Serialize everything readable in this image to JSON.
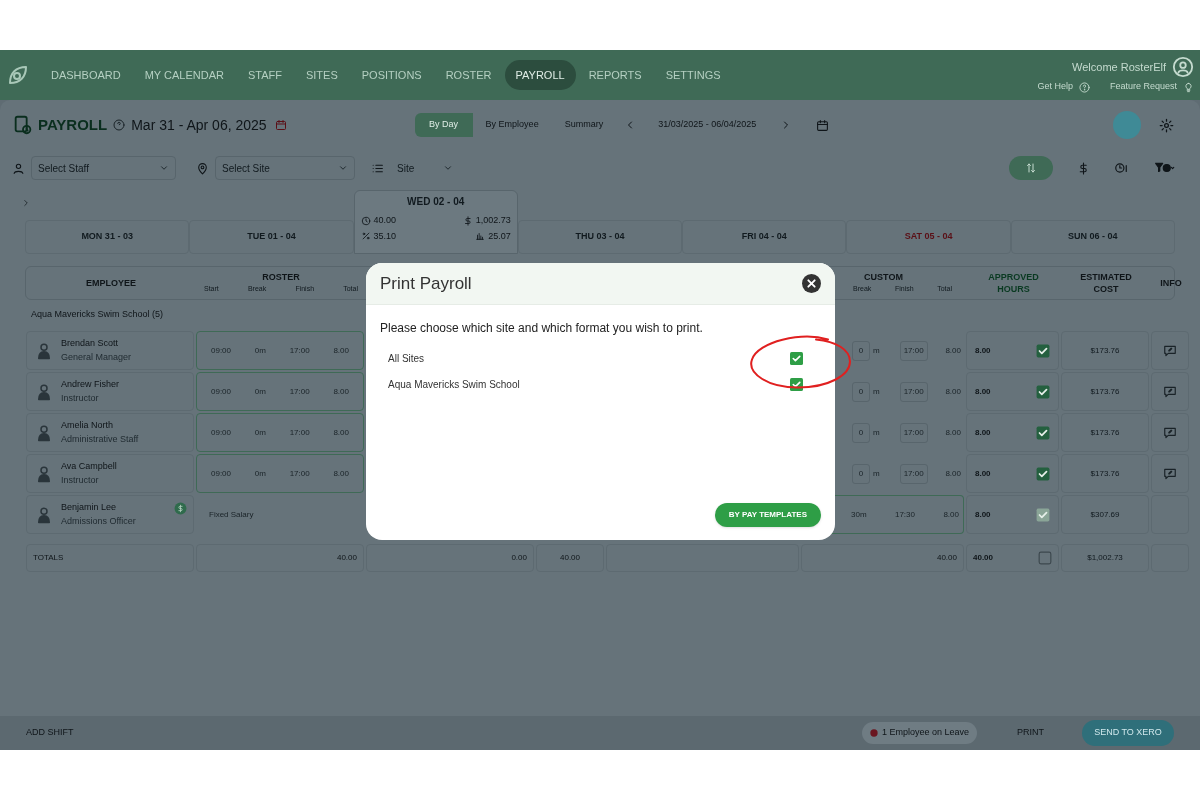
{
  "nav": {
    "items": [
      {
        "label": "DASHBOARD",
        "selected": false
      },
      {
        "label": "MY CALENDAR",
        "selected": false
      },
      {
        "label": "STAFF",
        "selected": false
      },
      {
        "label": "SITES",
        "selected": false
      },
      {
        "label": "POSITIONS",
        "selected": false
      },
      {
        "label": "ROSTER",
        "selected": false
      },
      {
        "label": "PAYROLL",
        "selected": true
      },
      {
        "label": "REPORTS",
        "selected": false
      },
      {
        "label": "SETTINGS",
        "selected": false
      }
    ],
    "welcome": "Welcome RosterElf",
    "help": "Get Help",
    "feature_request": "Feature Request"
  },
  "header": {
    "title": "PAYROLL",
    "date_range": "Mar 31 - Apr 06, 2025",
    "views": [
      {
        "label": "By Day",
        "selected": true
      },
      {
        "label": "By Employee",
        "selected": false
      },
      {
        "label": "Summary",
        "selected": false
      }
    ],
    "date_field": "31/03/2025 - 06/04/2025"
  },
  "filters": {
    "staff": {
      "placeholder": "Select Staff"
    },
    "site": {
      "placeholder": "Select Site"
    },
    "group_by": "Site"
  },
  "days": [
    {
      "label": "MON 31 - 03",
      "selected": false,
      "highlighted": false
    },
    {
      "label": "TUE 01 - 04",
      "selected": false,
      "highlighted": false
    },
    {
      "label": "WED 02 - 04",
      "selected": true,
      "highlighted": false,
      "stats": {
        "hours": "40.00",
        "cost": "1,002.73",
        "percent": "35.10",
        "average": "25.07"
      }
    },
    {
      "label": "THU 03 - 04",
      "selected": false,
      "highlighted": false
    },
    {
      "label": "FRI 04 - 04",
      "selected": false,
      "highlighted": false
    },
    {
      "label": "SAT 05 - 04",
      "selected": false,
      "highlighted": true
    },
    {
      "label": "SUN 06 - 04",
      "selected": false,
      "highlighted": false
    }
  ],
  "table": {
    "columns": [
      {
        "label": "EMPLOYEE",
        "accent": false
      },
      {
        "label": "ROSTER",
        "sub": [
          "Start",
          "Break",
          "Finish",
          "Total"
        ],
        "accent": false
      },
      {
        "label": "CUSTOM",
        "sub": [
          "Break",
          "Finish",
          "Total"
        ],
        "accent": false
      },
      {
        "label": "APPROVED HOURS",
        "accent": true
      },
      {
        "label": "ESTIMATED COST",
        "accent": false
      },
      {
        "label": "INFO",
        "accent": false
      }
    ],
    "group": "Aqua Mavericks Swim School (5)",
    "rows": [
      {
        "name": "Brendan Scott",
        "role": "General Manager",
        "kind": "shift",
        "roster": [
          "09:00",
          "0m",
          "17:00",
          "8.00"
        ],
        "custom": {
          "break": "0",
          "unit": "m",
          "finish": "17:00",
          "total": "8.00"
        },
        "approved": "8.00",
        "approved_checked": true,
        "approved_disabled": false,
        "cost": "$173.76",
        "note": true,
        "salary_badge": false
      },
      {
        "name": "Andrew Fisher",
        "role": "Instructor",
        "kind": "shift",
        "roster": [
          "09:00",
          "0m",
          "17:00",
          "8.00"
        ],
        "custom": {
          "break": "0",
          "unit": "m",
          "finish": "17:00",
          "total": "8.00"
        },
        "approved": "8.00",
        "approved_checked": true,
        "approved_disabled": false,
        "cost": "$173.76",
        "note": true,
        "salary_badge": false
      },
      {
        "name": "Amelia North",
        "role": "Administrative Staff",
        "kind": "shift",
        "roster": [
          "09:00",
          "0m",
          "17:00",
          "8.00"
        ],
        "custom": {
          "break": "0",
          "unit": "m",
          "finish": "17:00",
          "total": "8.00"
        },
        "approved": "8.00",
        "approved_checked": true,
        "approved_disabled": false,
        "cost": "$173.76",
        "note": true,
        "salary_badge": false
      },
      {
        "name": "Ava Campbell",
        "role": "Instructor",
        "kind": "shift",
        "roster": [
          "09:00",
          "0m",
          "17:00",
          "8.00"
        ],
        "custom": {
          "break": "0",
          "unit": "m",
          "finish": "17:00",
          "total": "8.00"
        },
        "approved": "8.00",
        "approved_checked": true,
        "approved_disabled": false,
        "cost": "$173.76",
        "note": true,
        "salary_badge": false
      },
      {
        "name": "Benjamin Lee",
        "role": "Admissions Officer",
        "kind": "salary",
        "roster_text": "Fixed Salary",
        "custom": {
          "break": "30m",
          "finish": "17:30",
          "total": "8.00"
        },
        "approved": "8.00",
        "approved_checked": true,
        "approved_disabled": true,
        "cost": "$307.69",
        "note": false,
        "salary_badge": true
      }
    ],
    "totals": {
      "label": "TOTALS",
      "roster_total": "40.00",
      "middle": [
        "0.00",
        "40.00"
      ],
      "custom_total": "40.00",
      "approved": "40.00",
      "approved_checked": false,
      "cost": "$1,002.73"
    }
  },
  "footer": {
    "add_shift": "ADD SHIFT",
    "leave": "1 Employee on Leave",
    "print": "PRINT",
    "send": "SEND TO XERO"
  },
  "modal": {
    "title": "Print Payroll",
    "prompt": "Please choose which site and which format you wish to print.",
    "options": [
      {
        "label": "All Sites",
        "checked": true
      },
      {
        "label": "Aqua Mavericks Swim School",
        "checked": true
      }
    ],
    "button": "BY PAY TEMPLATES"
  }
}
